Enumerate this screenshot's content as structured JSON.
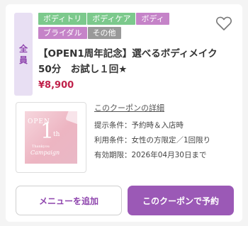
{
  "badge": {
    "char1": "全",
    "char2": "員"
  },
  "tags": [
    {
      "label": "ボディトリ",
      "color": "green"
    },
    {
      "label": "ボディケア",
      "color": "green"
    },
    {
      "label": "ボディ",
      "color": "pink"
    },
    {
      "label": "ブライダル",
      "color": "pink"
    },
    {
      "label": "その他",
      "color": "gray"
    }
  ],
  "coupon": {
    "title": "【OPEN1周年記念】選べるボディメイク50分　お試し１回★",
    "price": "¥8,900",
    "detail_link": "このクーポンの詳細",
    "conditions": [
      "提示条件：予約時＆入店時",
      "利用条件：女性の方限定／1回限り",
      "有効期限：2026年04月30日まで"
    ]
  },
  "thumbnail": {
    "open": "OPEN",
    "number": "1",
    "suffix": "th",
    "thanks": "Thankyou",
    "campaign": "Campaign"
  },
  "buttons": {
    "add_menu": "メニューを追加",
    "book": "このクーポンで予約"
  },
  "icons": {
    "favorite": "heart-outline-icon"
  },
  "colors": {
    "accent": "#9b59b6",
    "price": "#c0224b",
    "tag_green": "#7cc98c",
    "tag_pink": "#c583c8"
  }
}
